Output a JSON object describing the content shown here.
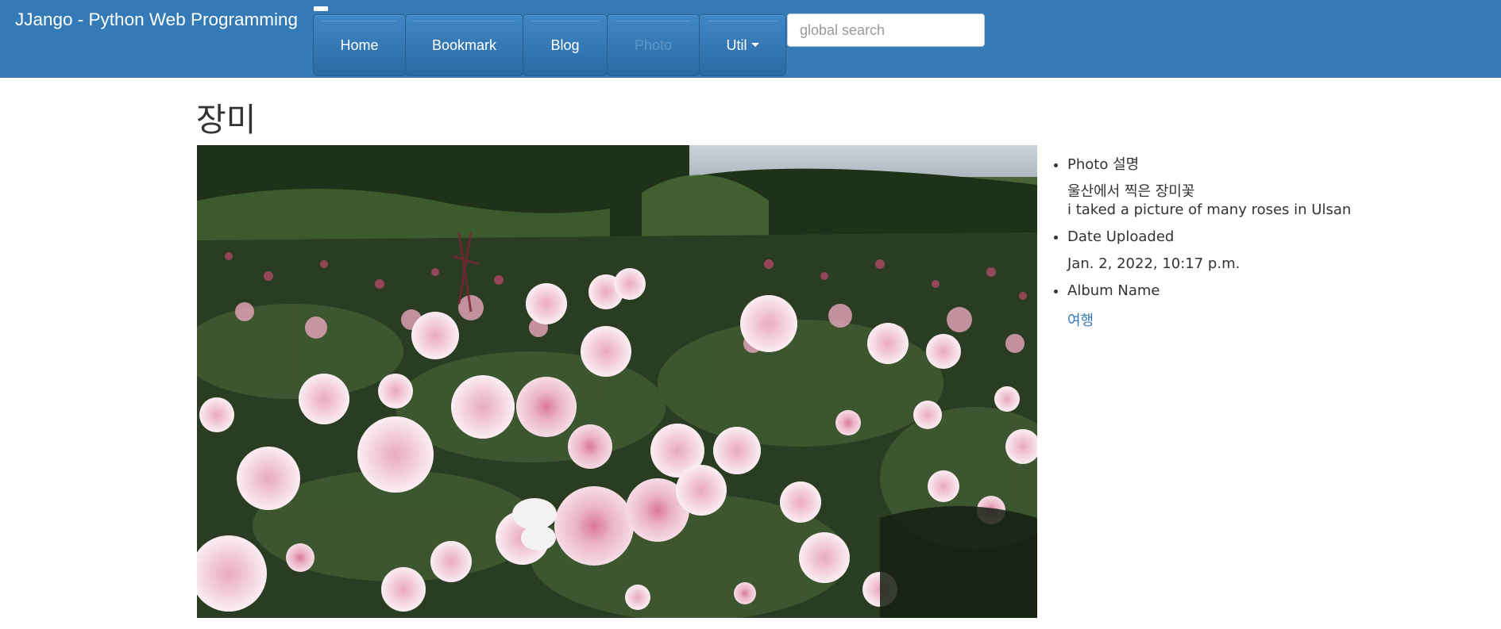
{
  "brand": "JJango - Python Web Programming",
  "nav": {
    "home": "Home",
    "bookmark": "Bookmark",
    "blog": "Blog",
    "photo": "Photo",
    "util": "Util"
  },
  "search": {
    "placeholder": "global search"
  },
  "photo": {
    "title": "장미",
    "description_label": "Photo 설명",
    "description_ko": "울산에서 찍은 장미꽃",
    "description_en": "i taked a picture of many roses in Ulsan",
    "date_label": "Date Uploaded",
    "date_value": "Jan. 2, 2022, 10:17 p.m.",
    "album_label": "Album Name",
    "album_value": "여행"
  },
  "colors": {
    "navbar": "#337ab7",
    "link": "#337ab7",
    "text": "#333333"
  },
  "icons": [
    "caret-down-icon",
    "menu-toggle-icon"
  ]
}
